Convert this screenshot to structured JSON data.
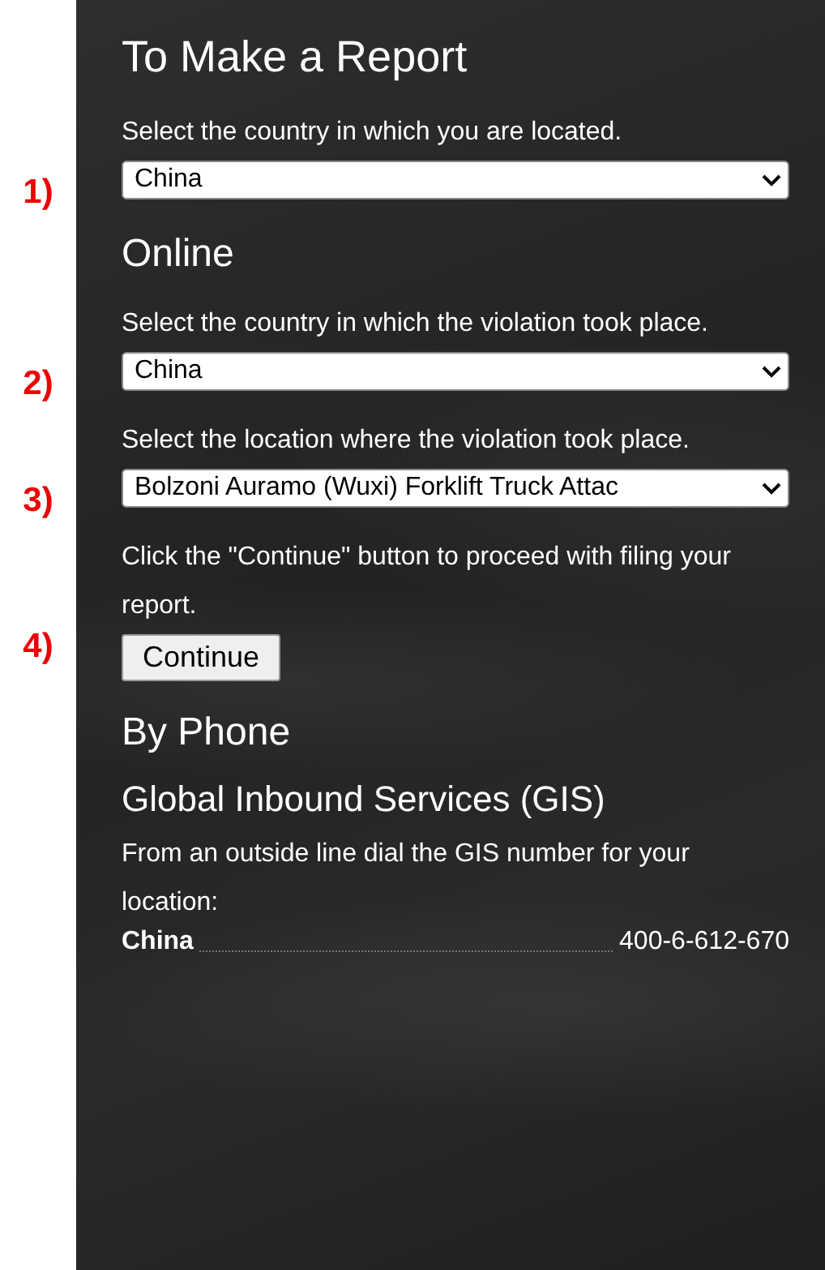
{
  "title": "To Make a Report",
  "location_step": {
    "marker": "1)",
    "instruction": "Select the country in which you are located.",
    "control": {
      "kind": "select",
      "value": "China"
    }
  },
  "online": {
    "heading": "Online",
    "steps": [
      {
        "marker": "2)",
        "instruction": "Select the country in which the violation took place.",
        "control": {
          "kind": "select",
          "value": "China"
        }
      },
      {
        "marker": "3)",
        "instruction": "Select the location where the violation took place.",
        "control": {
          "kind": "select",
          "value": "Bolzoni Auramo (Wuxi) Forklift Truck Attac"
        }
      },
      {
        "marker": "4)",
        "instruction": "Click the \"Continue\" button to proceed with filing your report.",
        "control": {
          "kind": "button",
          "label": "Continue"
        }
      }
    ]
  },
  "by_phone": {
    "heading": "By Phone",
    "subheading": "Global Inbound Services (GIS)",
    "instruction": "From an outside line dial the GIS number for your location:",
    "numbers": [
      {
        "country": "China",
        "number": "400-6-612-670"
      }
    ]
  }
}
